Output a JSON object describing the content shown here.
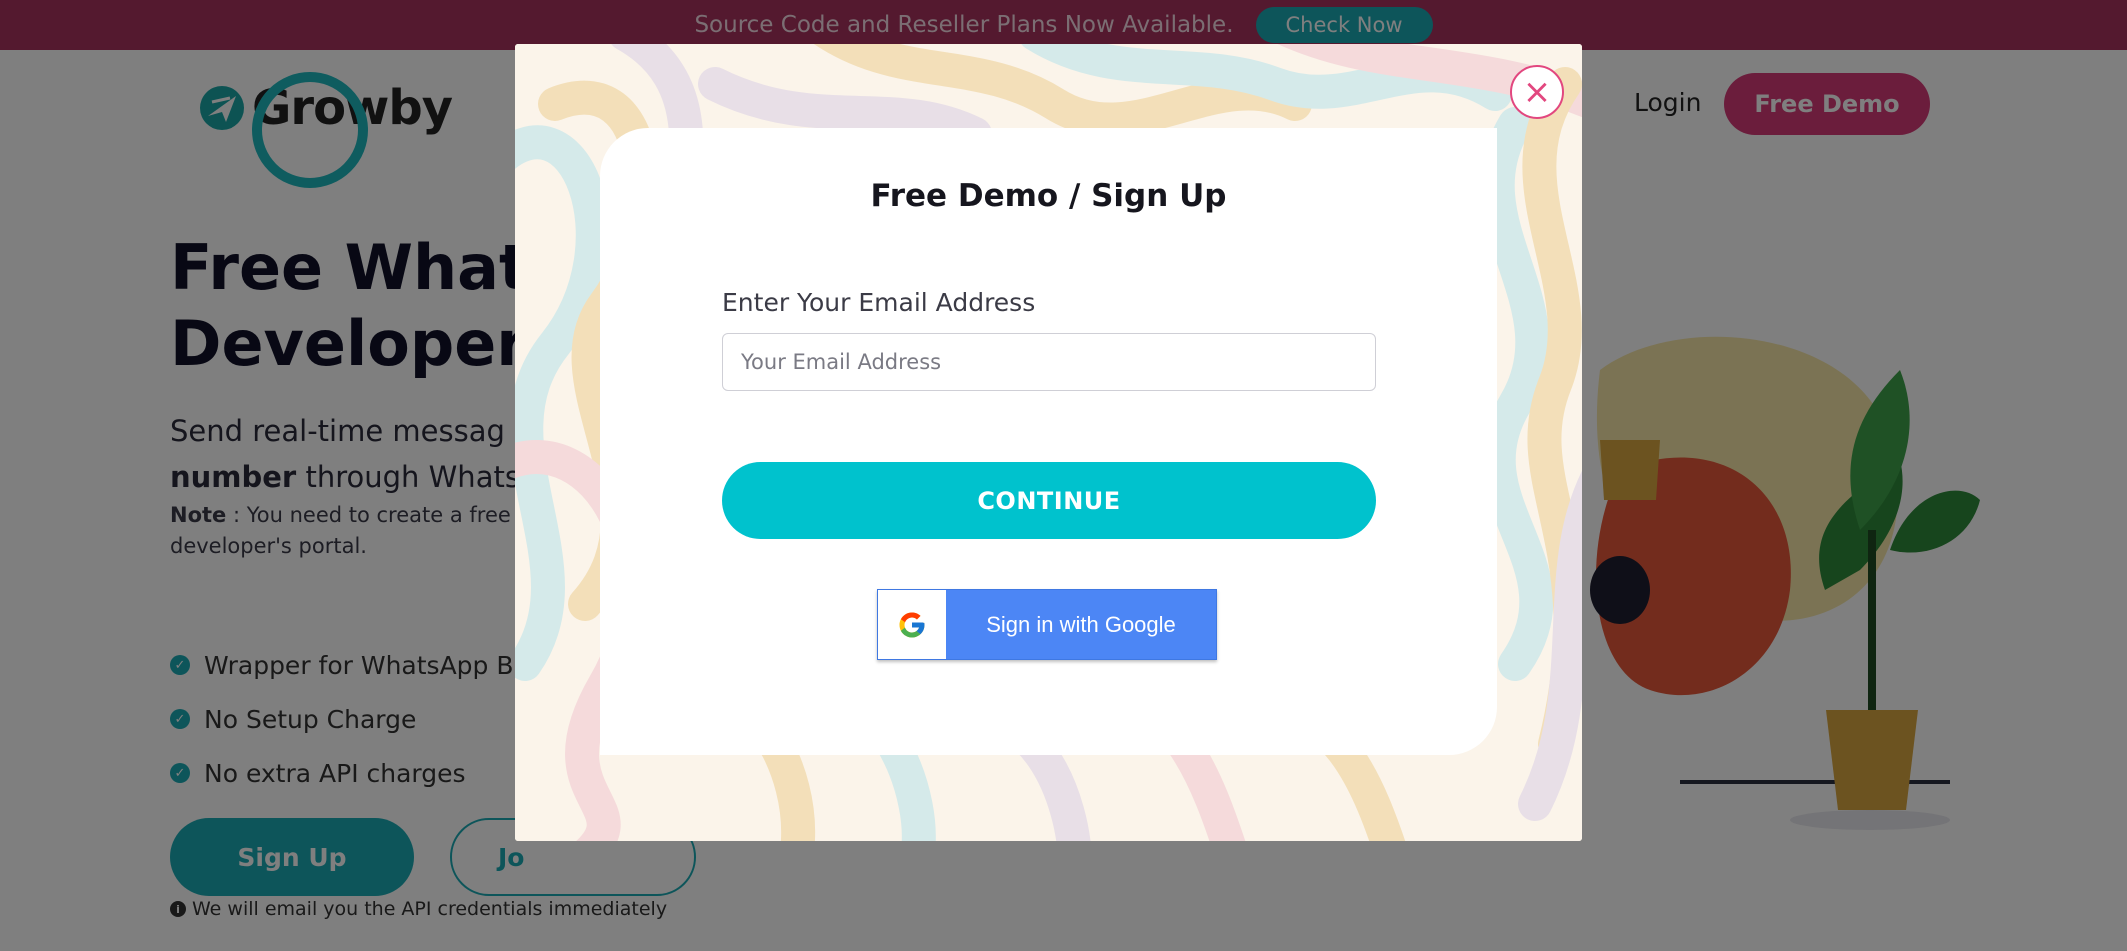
{
  "banner": {
    "text": "Source Code and Reseller Plans Now Available.",
    "button_label": "Check Now"
  },
  "brand": {
    "name": "Growby"
  },
  "nav": {
    "login_label": "Login",
    "demo_label": "Free Demo"
  },
  "hero": {
    "title_line1": "Free Whats",
    "title_line2": "Developers",
    "subtitle_line1": "Send real-time messag",
    "subtitle_bold": "number",
    "subtitle_line2_rest": " through Whats",
    "note_label": "Note",
    "note_text_line1": " : You need to create a free d",
    "note_text_line2": "developer's portal.",
    "features": [
      "Wrapper for WhatsApp Bu",
      "No Setup Charge",
      "No extra API charges"
    ],
    "signup_label": "Sign Up",
    "outline_label": "Jo",
    "email_note": "We will email you the API credentials immediately"
  },
  "modal": {
    "title": "Free Demo / Sign Up",
    "email_label": "Enter Your Email Address",
    "email_placeholder": "Your Email Address",
    "email_value": "",
    "continue_label": "CONTINUE",
    "google_label": "Sign in with Google",
    "close_symbol": "×"
  },
  "colors": {
    "banner_bg": "#a8325e",
    "accent_teal": "#1aaab4",
    "continue_cyan": "#00c2cd",
    "brand_pink": "#d63b79",
    "google_blue": "#4c86f5"
  },
  "icons": [
    "close-icon",
    "google-g-icon",
    "check-icon",
    "info-icon",
    "growby-logo-icon"
  ]
}
